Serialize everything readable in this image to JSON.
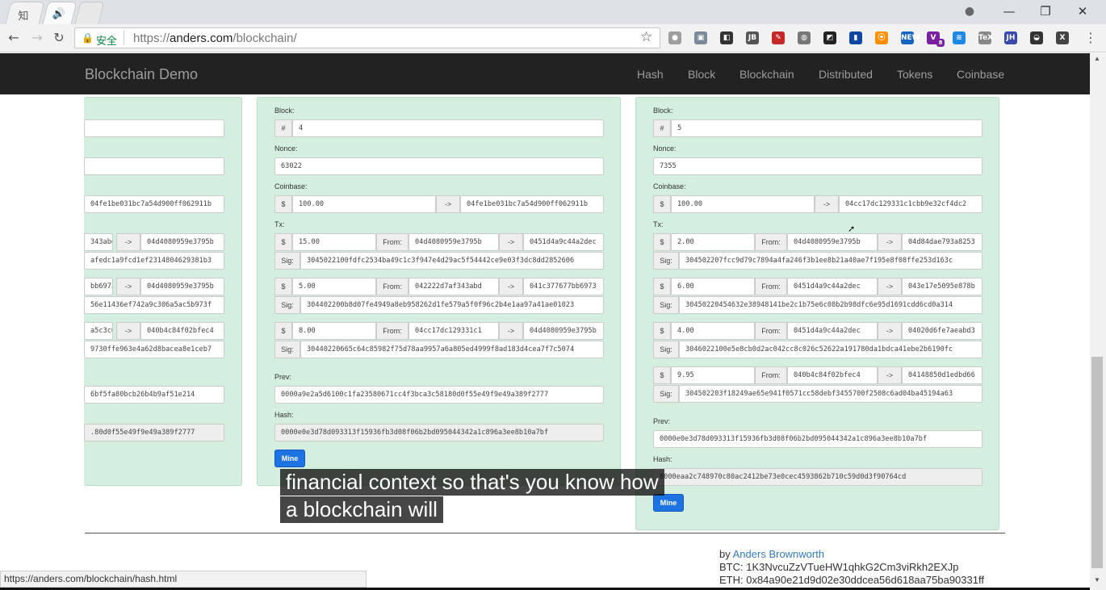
{
  "browser": {
    "tabs": [
      {
        "icon_text": "知"
      },
      {
        "icon_text": "🔊"
      },
      {
        "icon_text": ""
      }
    ],
    "window_controls": {
      "minimize": "—",
      "restore": "❐",
      "close": "✕"
    },
    "address": {
      "secure_label": "安全",
      "scheme": "https://",
      "host": "anders.com",
      "path": "/blockchain/"
    },
    "extensions": [
      "●",
      "▣",
      "◧",
      "JB",
      "✎",
      "◍",
      "◩",
      "▮",
      "⦿",
      "NEW",
      "V",
      "≋",
      "TeX",
      "JH",
      "◒",
      "X"
    ],
    "extension_badge": "8",
    "status_url": "https://anders.com/blockchain/hash.html"
  },
  "nav": {
    "brand": "Blockchain Demo",
    "links": [
      "Hash",
      "Block",
      "Blockchain",
      "Distributed",
      "Tokens",
      "Coinbase"
    ]
  },
  "labels": {
    "block": "Block:",
    "nonce": "Nonce:",
    "coinbase": "Coinbase:",
    "tx": "Tx:",
    "prev": "Prev:",
    "hash": "Hash:",
    "hash_sym": "#",
    "dollar": "$",
    "arrow": "->",
    "from": "From:",
    "sig": "Sig:",
    "mine": "Mine"
  },
  "left_block": {
    "row1": "",
    "row2": "",
    "coinbase_to": "04fe1be031bc7a54d900ff062911b",
    "tx": [
      {
        "amount_tail": "343abd",
        "to": "04d4080959e3795b",
        "sig_tail": "afedc1a9fcd1ef2314804629381b3"
      },
      {
        "amount_tail": "bb6973",
        "to": "04d4080959e3795b",
        "sig_tail": "56e11436ef742a9c306a5ac5b973f"
      },
      {
        "amount_tail": "a5c3c0",
        "to": "040b4c84f02bfec4",
        "sig_tail": "9730ffe963e4a62d8bacea8e1ceb7"
      }
    ],
    "prev_tail": "6bf5fa80bcb26b4b9af51e214",
    "hash_tail": ".80d0f55e49f9e49a389f2777"
  },
  "block4": {
    "number": "4",
    "nonce": "63022",
    "coinbase_amount": "100.00",
    "coinbase_to": "04fe1be031bc7a54d900ff062911b",
    "tx": [
      {
        "amount": "15.00",
        "from": "04d4080959e3795b",
        "to": "0451d4a9c44a2dec",
        "sig": "3045022100fdfc2534ba49c1c3f947e4d29ac5f54442ce9e03f3dc8dd2852606"
      },
      {
        "amount": "5.00",
        "from": "042222d7af343abd",
        "to": "041c377677bb6973",
        "sig": "304402200b8d07fe4949a8eb958262d1fe579a5f0f96c2b4e1aa97a41ae01023"
      },
      {
        "amount": "8.00",
        "from": "04cc17dc129331c1",
        "to": "04d4080959e3795b",
        "sig": "30440220665c64c85982f75d78aa9957a6a805ed4999f8ad183d4cea7f7c5074"
      }
    ],
    "prev": "0000a9e2a5d6100c1fa23580671cc4f3bca3c58180d0f55e49f9e49a389f2777",
    "hash": "0000e0e3d78d093313f15936fb3d08f06b2bd095044342a1c896a3ee8b10a7bf"
  },
  "block5": {
    "number": "5",
    "nonce": "7355",
    "coinbase_amount": "100.00",
    "coinbase_to": "04cc17dc129331c1cbb9e32cf4dc2",
    "tx": [
      {
        "amount": "2.00",
        "from": "04d4080959e3795b",
        "to": "04d84dae793a8253",
        "sig": "304502207fcc9d79c7894a4fa246f3b1ee8b21a40ae7f195e8f08ffe253d163c"
      },
      {
        "amount": "6.00",
        "from": "0451d4a9c44a2dec",
        "to": "043e17e5095e878b",
        "sig": "30450220454632e38948141be2c1b75e6c08b2b98dfc6e95d1691cdd6cd0a314"
      },
      {
        "amount": "4.00",
        "from": "0451d4a9c44a2dec",
        "to": "04020d6fe7aeabd3",
        "sig": "3046022100e5e8cb0d2ac042cc8c026c52622a191780da1bdca41ebe2b6190fc"
      },
      {
        "amount": "9.95",
        "from": "040b4c84f02bfec4",
        "to": "04148850d1edbd66",
        "sig": "304502203f18249ae65e941f0571cc58debf3455700f2508c6ad04ba45194a63"
      }
    ],
    "prev": "0000e0e3d78d093313f15936fb3d08f06b2bd095044342a1c896a3ee8b10a7bf",
    "hash": "0000eaa2c748970c80ac2412be73e0cec4593862b710c59d0d3f90764cd"
  },
  "captions": [
    "financial context so that's you know how",
    "a blockchain will"
  ],
  "footer": {
    "by": "by",
    "author": "Anders Brownworth",
    "btc": "BTC: 1K3NvcuZzVTueHW1qhkG2Cm3viRkh2EXJp",
    "eth": "ETH: 0x84a90e21d9d02e30ddcea56d618aa75ba90331ff"
  }
}
